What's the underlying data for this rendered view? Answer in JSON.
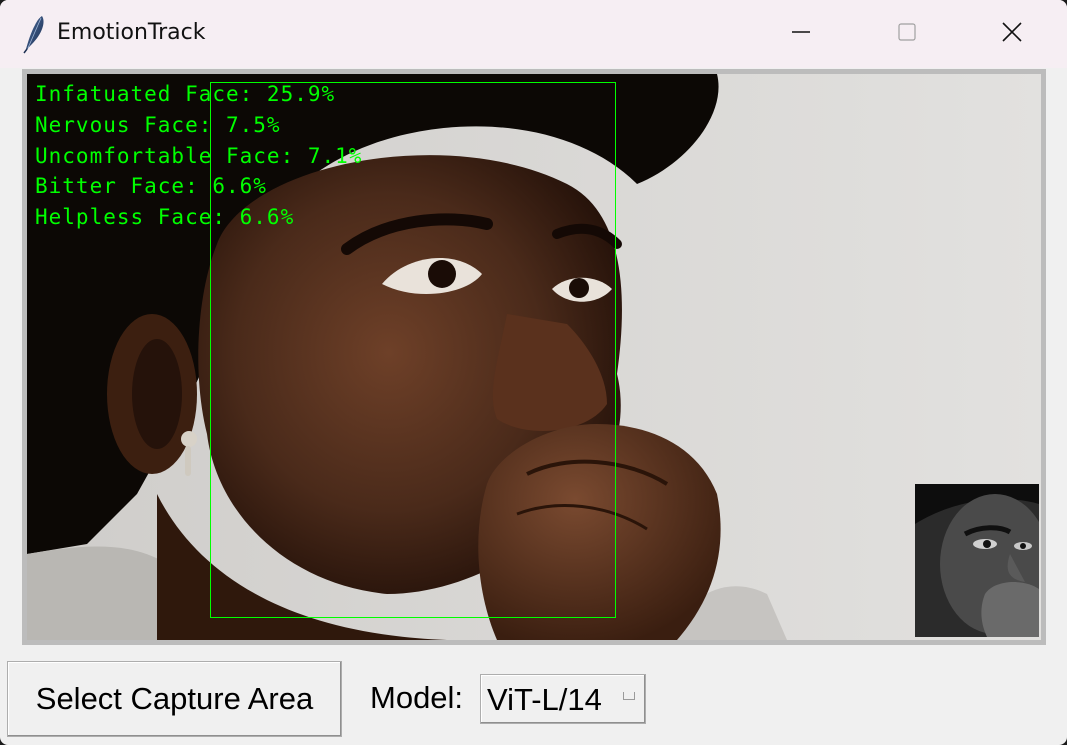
{
  "window": {
    "title": "EmotionTrack",
    "app_icon": "feather-icon",
    "controls": {
      "minimize": "minimize-icon",
      "maximize": "maximize-icon",
      "close": "close-icon"
    }
  },
  "capture": {
    "emotions": [
      {
        "text": "Infatuated Face: 25.9%"
      },
      {
        "text": "Nervous Face: 7.5%"
      },
      {
        "text": "Uncomfortable Face: 7.1%"
      },
      {
        "text": "Bitter Face: 6.6%"
      },
      {
        "text": "Helpless Face: 6.6%"
      }
    ],
    "overlay_color": "#00ff00"
  },
  "controls": {
    "capture_button": "Select Capture Area",
    "model_label": "Model:",
    "model_value": "ViT-L/14"
  }
}
